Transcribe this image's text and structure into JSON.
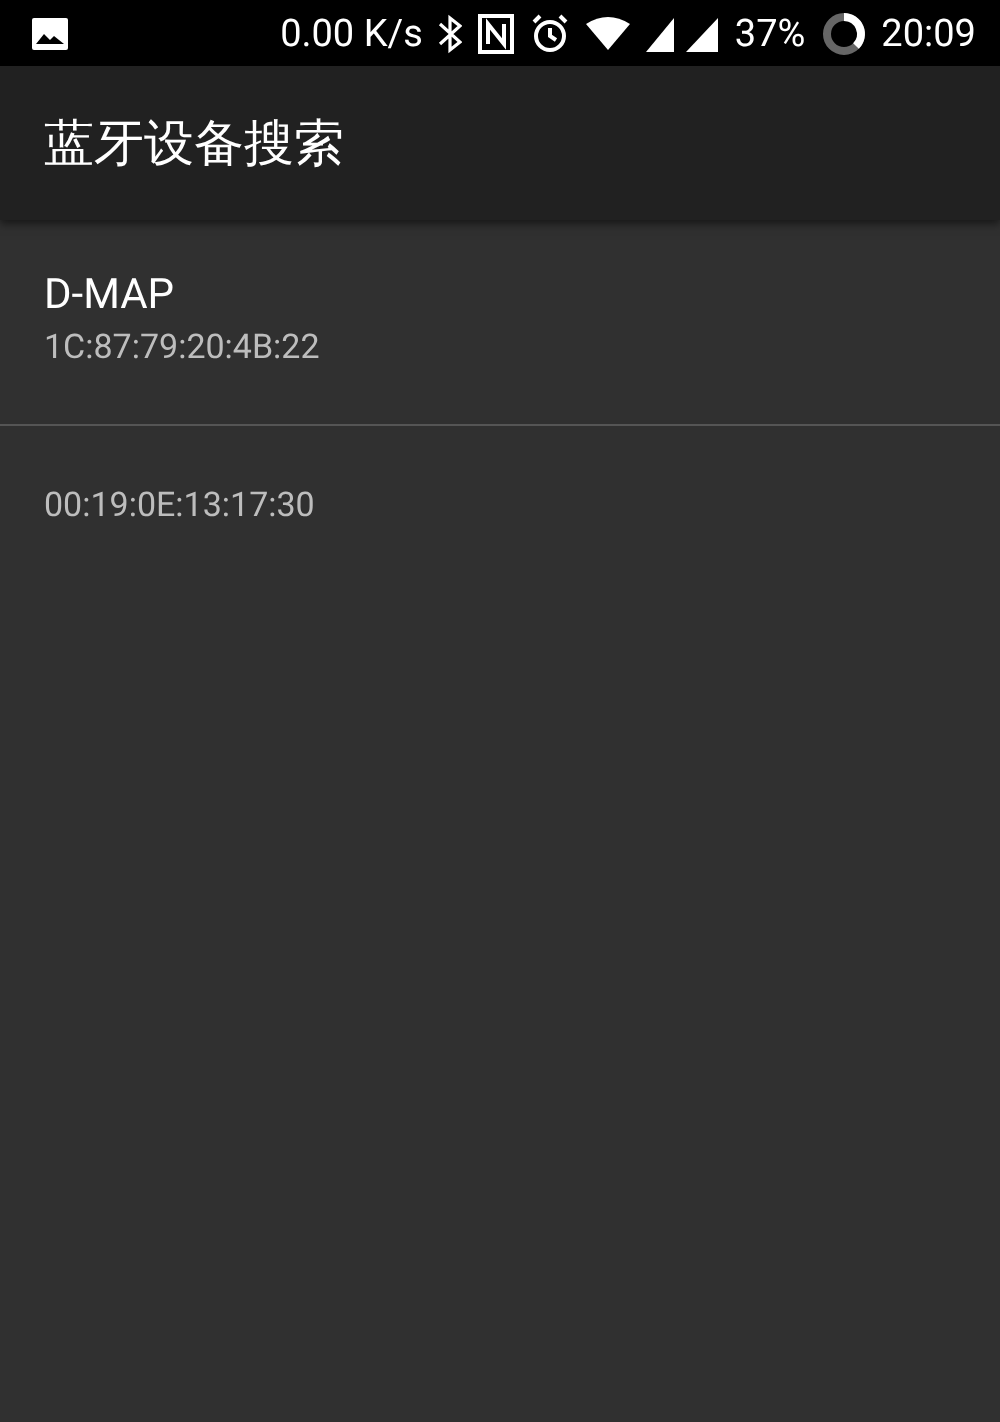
{
  "status_bar": {
    "speed": "0.00 K/s",
    "battery": "37%",
    "time": "20:09"
  },
  "app_bar": {
    "title": "蓝牙设备搜索"
  },
  "devices": [
    {
      "name": "D-MAP",
      "address": "1C:87:79:20:4B:22"
    },
    {
      "address": "00:19:0E:13:17:30"
    }
  ]
}
